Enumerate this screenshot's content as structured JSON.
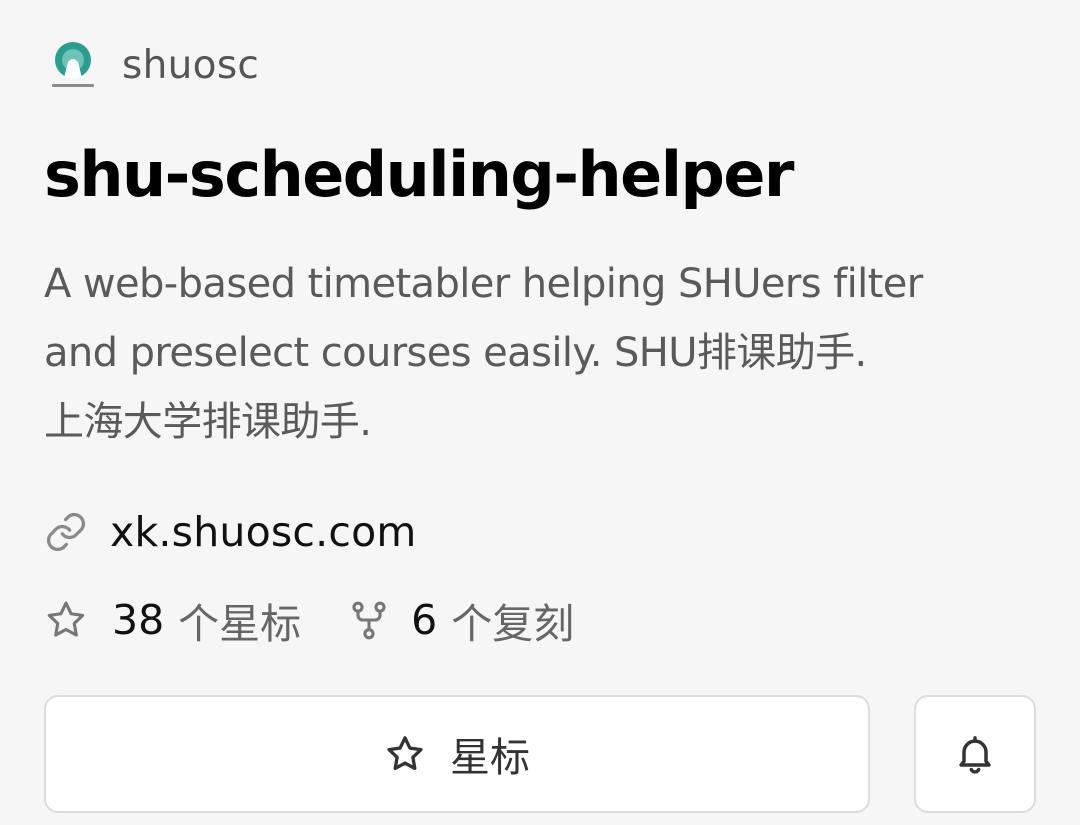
{
  "owner": {
    "name": "shuosc",
    "avatar_icon": "shuosc-logo",
    "avatar_color": "#2a9d8f"
  },
  "repo": {
    "title": "shu-scheduling-helper",
    "description_lines": [
      "A web-based timetabler helping SHUers filter",
      "and preselect courses easily. SHU排课助手.",
      "上海大学排课助手."
    ],
    "website": {
      "icon": "link-icon",
      "text": "xk.shuosc.com"
    }
  },
  "stats": {
    "stars": {
      "icon": "star-icon",
      "count": "38",
      "label": "个星标"
    },
    "forks": {
      "icon": "fork-icon",
      "count": "6",
      "label": "个复刻"
    }
  },
  "actions": {
    "star_button": {
      "icon": "star-icon",
      "label": "星标"
    },
    "notify_button": {
      "icon": "bell-icon"
    }
  },
  "colors": {
    "background": "#f6f6f6",
    "button_border": "#dddddd",
    "icon_gray": "#777777"
  }
}
